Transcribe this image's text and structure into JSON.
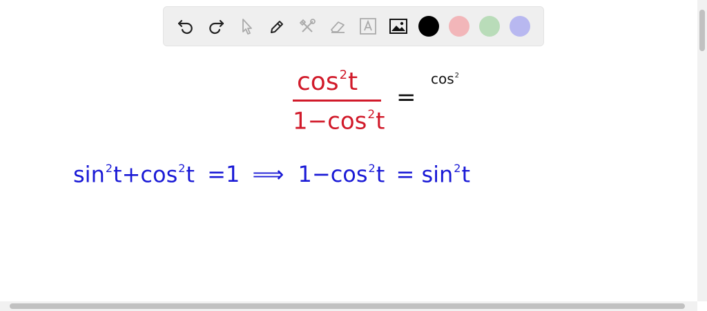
{
  "toolbar": {
    "tools": [
      "undo-icon",
      "redo-icon",
      "select-icon",
      "pen-icon",
      "tools-icon",
      "eraser-icon",
      "text-icon",
      "image-icon"
    ],
    "colors": {
      "black": "#000000",
      "red": "#f2b6b9",
      "green": "#b9dcb9",
      "blue": "#b8b8f0"
    }
  },
  "board": {
    "fraction_numerator": "cos",
    "fraction_numerator_sup": "2",
    "fraction_numerator_var": "t",
    "fraction_denominator": "1−cos",
    "fraction_denominator_sup": "2",
    "fraction_denominator_var": "t",
    "equals_1": "=",
    "rhs_partial": "cos",
    "rhs_partial_sup": "2",
    "identity_sin": "sin",
    "identity_sin_sup": "2",
    "identity_t1": "t",
    "identity_plus_cos": "+cos",
    "identity_cos_sup": "2",
    "identity_t2": "t",
    "identity_equals_one": "=1",
    "implies": "⟹",
    "result_lhs": "1−cos",
    "result_lhs_sup": "2",
    "result_t": "t",
    "result_equals": "=",
    "result_sin": "sin",
    "result_sin_sup": "2",
    "result_t2": "t"
  },
  "ink_colors": {
    "red": "#d11a2a",
    "blue": "#1a1ad6",
    "black": "#111111"
  }
}
